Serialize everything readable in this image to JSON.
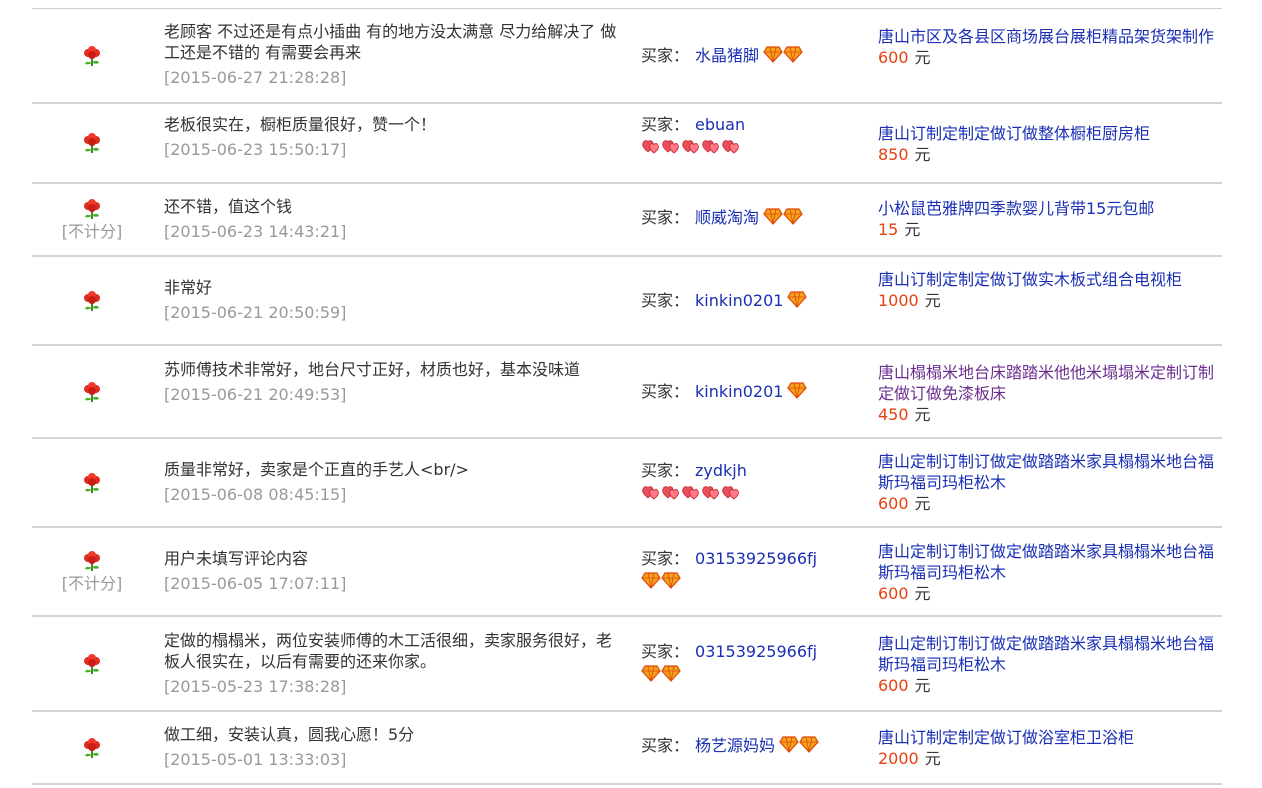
{
  "colors": {
    "link": "#1a2fb3",
    "visited_link": "#6b2f8f",
    "price": "#e8400f",
    "muted": "#999999",
    "divider": "#d4d4d4"
  },
  "labels": {
    "buyer_prefix": "买家：",
    "currency": "元",
    "not_counted": "[不计分]"
  },
  "reviews": [
    {
      "comment": "老顾客 不过还是有点小插曲 有的地方没太满意 尽力给解决了 做工还是不错的 有需要会再来",
      "date": "[2015-06-27 21:28:28]",
      "buyer": "水晶猪脚",
      "badge_type": "diamond",
      "badge_count": 2,
      "badge_inline": true,
      "item_title": "唐山市区及各县区商场展台展柜精品架货架制作",
      "price": "600",
      "not_counted": false
    },
    {
      "comment": "老板很实在，橱柜质量很好，赞一个！",
      "date": "[2015-06-23 15:50:17]",
      "buyer": "ebuan",
      "badge_type": "heart",
      "badge_count": 5,
      "badge_inline": false,
      "item_title": "唐山订制定制定做订做整体橱柜厨房柜",
      "price": "850",
      "not_counted": false
    },
    {
      "comment": "还不错，值这个钱",
      "date": "[2015-06-23 14:43:21]",
      "buyer": "顺威淘淘",
      "badge_type": "diamond",
      "badge_count": 2,
      "badge_inline": true,
      "item_title": "小松鼠芭雅牌四季款婴儿背带15元包邮",
      "price": "15",
      "not_counted": true
    },
    {
      "comment": "非常好",
      "date": "[2015-06-21 20:50:59]",
      "buyer": "kinkin0201",
      "badge_type": "diamond",
      "badge_count": 1,
      "badge_inline": true,
      "item_title": "唐山订制定制定做订做实木板式组合电视柜",
      "price": "1000",
      "not_counted": false
    },
    {
      "comment": "苏师傅技术非常好，地台尺寸正好，材质也好，基本没味道",
      "date": "[2015-06-21 20:49:53]",
      "buyer": "kinkin0201",
      "badge_type": "diamond",
      "badge_count": 1,
      "badge_inline": true,
      "item_title": "唐山榻榻米地台床踏踏米他他米塌塌米定制订制定做订做免漆板床",
      "price": "450",
      "not_counted": false,
      "visited": true
    },
    {
      "comment": "质量非常好，卖家是个正直的手艺人<br/>",
      "date": "[2015-06-08 08:45:15]",
      "buyer": "zydkjh",
      "badge_type": "heart",
      "badge_count": 5,
      "badge_inline": false,
      "item_title": "唐山定制订制订做定做踏踏米家具榻榻米地台福斯玛福司玛柜松木",
      "price": "600",
      "not_counted": false
    },
    {
      "comment": "用户未填写评论内容",
      "date": "[2015-06-05 17:07:11]",
      "buyer": "03153925966fj",
      "badge_type": "diamond",
      "badge_count": 2,
      "badge_inline": false,
      "item_title": "唐山定制订制订做定做踏踏米家具榻榻米地台福斯玛福司玛柜松木",
      "price": "600",
      "not_counted": true
    },
    {
      "comment": "定做的榻榻米，两位安装师傅的木工活很细，卖家服务很好，老板人很实在，以后有需要的还来你家。",
      "date": "[2015-05-23 17:38:28]",
      "buyer": "03153925966fj",
      "badge_type": "diamond",
      "badge_count": 2,
      "badge_inline": false,
      "item_title": "唐山定制订制订做定做踏踏米家具榻榻米地台福斯玛福司玛柜松木",
      "price": "600",
      "not_counted": false
    },
    {
      "comment": "做工细，安装认真，圆我心愿！5分",
      "date": "[2015-05-01 13:33:03]",
      "buyer": "杨艺源妈妈",
      "badge_type": "diamond",
      "badge_count": 2,
      "badge_inline": true,
      "item_title": "唐山订制定制定做订做浴室柜卫浴柜",
      "price": "2000",
      "not_counted": false
    }
  ]
}
